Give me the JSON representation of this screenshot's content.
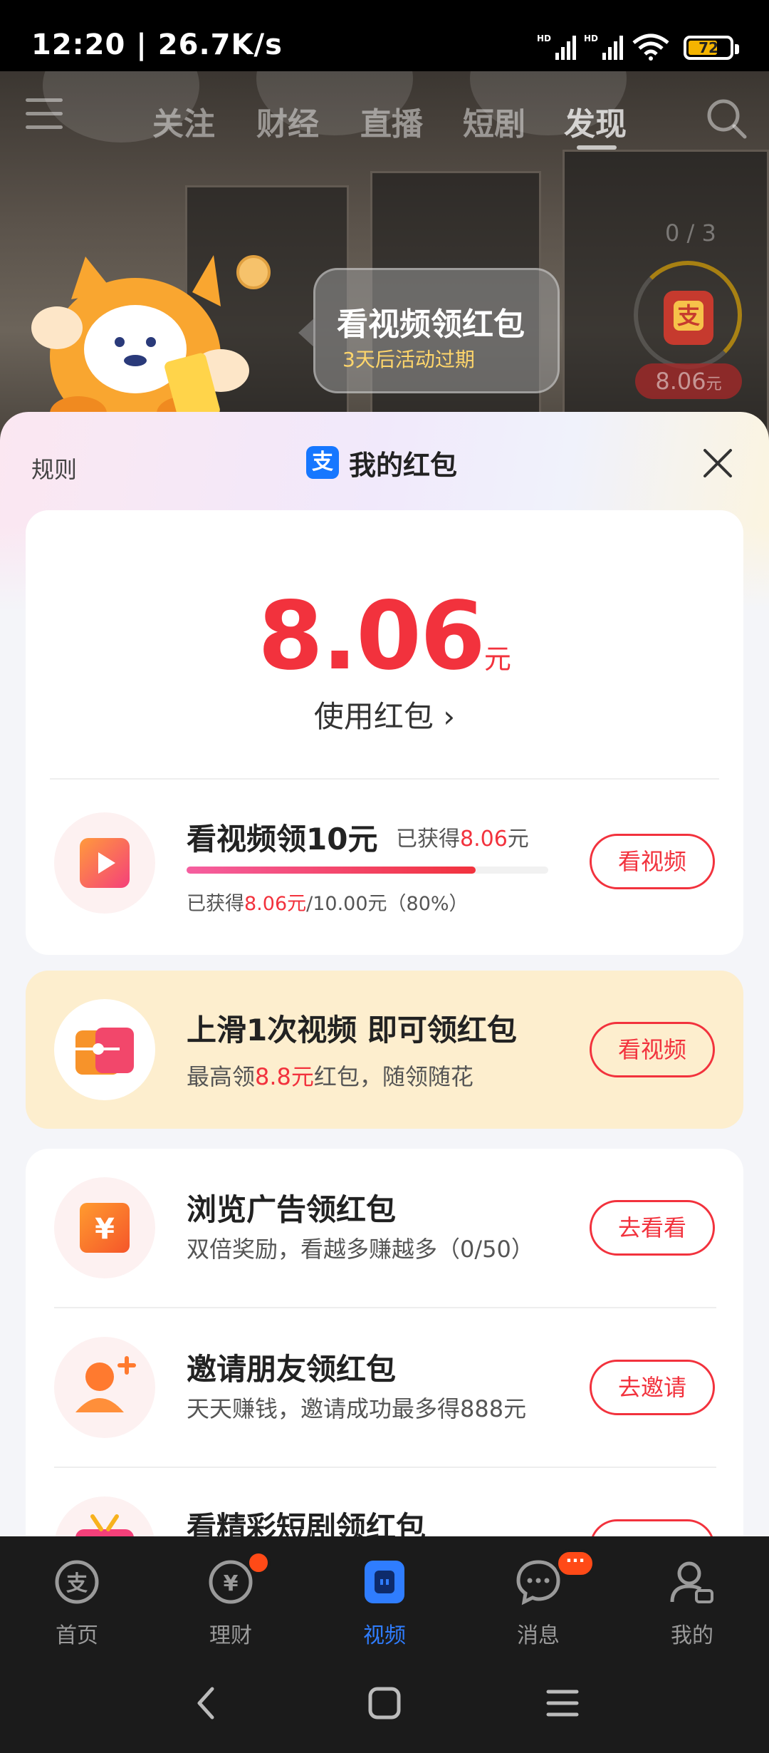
{
  "status_bar": {
    "time": "12:20 | 26.7K/s",
    "battery": "72"
  },
  "top_nav": {
    "tabs": [
      {
        "label": "关注"
      },
      {
        "label": "财经"
      },
      {
        "label": "直播"
      },
      {
        "label": "短剧"
      },
      {
        "label": "发现"
      }
    ],
    "active_tab": "发现"
  },
  "video_overlay": {
    "bubble_title": "看视频领红包",
    "bubble_sub": "3天后活动过期",
    "count": "0 / 3",
    "amount": "8.06",
    "amount_unit": "元",
    "env_glyph": "支"
  },
  "sheet": {
    "rules": "规则",
    "logo_glyph": "支",
    "title": "我的红包",
    "balance": {
      "amount": "8.06",
      "unit": "元",
      "use_label": "使用红包 ›"
    },
    "progress_task": {
      "title": "看视频领10元",
      "earned_prefix": "已获得",
      "earned_value": "8.06",
      "earned_unit": "元",
      "detail_prefix": "已获得",
      "detail_value": "8.06元",
      "detail_suffix": "/10.00元（80%）",
      "progress": 0.8,
      "button": "看视频"
    },
    "swipe_task": {
      "title": "上滑1次视频 即可领红包",
      "sub_prefix": "最高领",
      "sub_value": "8.8元",
      "sub_suffix": "红包，随领随花",
      "button": "看视频"
    },
    "tasks": [
      {
        "title": "浏览广告领红包",
        "sub": "双倍奖励，看越多赚越多（0/50）",
        "button": "去看看",
        "icon": "yuan-icon"
      },
      {
        "title": "邀请朋友领红包",
        "sub": "天天赚钱，邀请成功最多得888元",
        "button": "去邀请",
        "icon": "add-friend-icon"
      },
      {
        "title": "看精彩短剧领红包",
        "sub": "",
        "button": "",
        "icon": "tv-icon"
      }
    ]
  },
  "bottom_nav": {
    "items": [
      {
        "label": "首页",
        "icon": "alipay-icon"
      },
      {
        "label": "理财",
        "icon": "wealth-icon"
      },
      {
        "label": "视频",
        "icon": "video-icon"
      },
      {
        "label": "消息",
        "icon": "message-icon"
      },
      {
        "label": "我的",
        "icon": "profile-icon"
      }
    ],
    "active": "视频",
    "message_badge": "···",
    "yuan_glyph": "¥",
    "alipay_glyph": "支"
  },
  "colors": {
    "accent_red": "#f2323d",
    "active_blue": "#2f7dff",
    "card2_bg": "#fdeece"
  }
}
